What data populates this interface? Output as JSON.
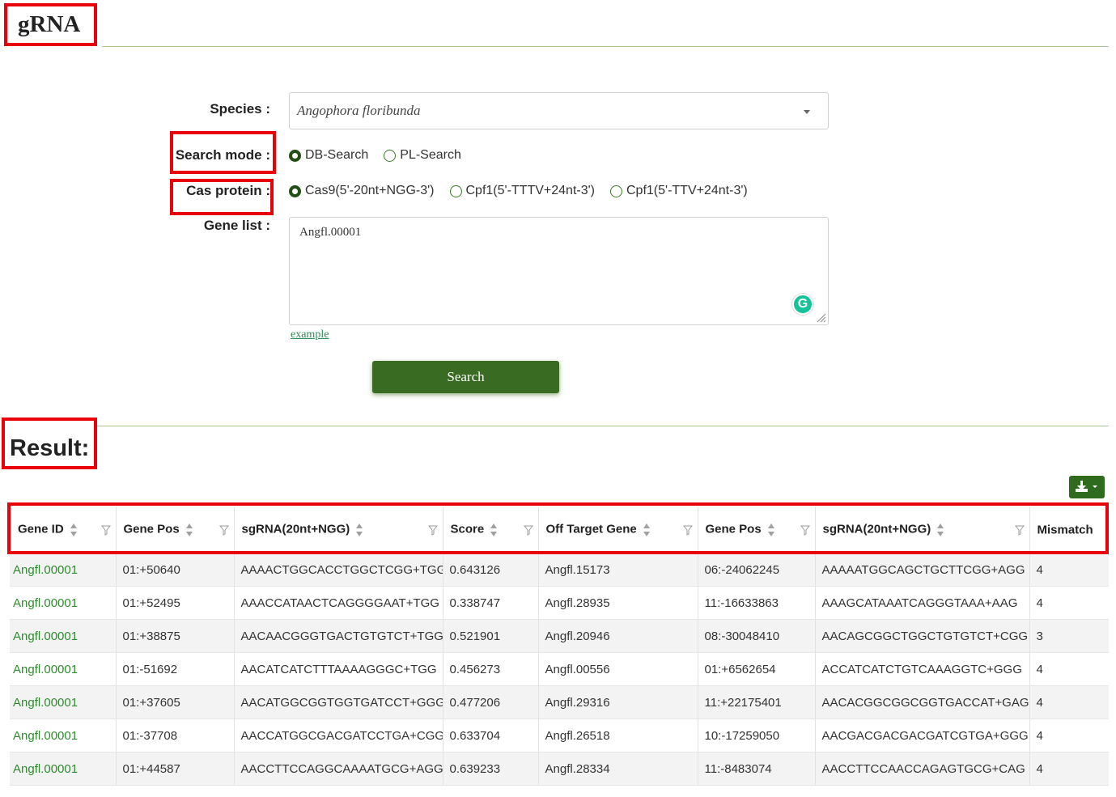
{
  "page": {
    "title": "gRNA",
    "result_heading": "Result:"
  },
  "form": {
    "species_label": "Species :",
    "species_value": "Angophora floribunda",
    "search_mode_label": "Search mode :",
    "search_mode_options": [
      {
        "label": "DB-Search",
        "selected": true
      },
      {
        "label": "PL-Search",
        "selected": false
      }
    ],
    "cas_label": "Cas protein :",
    "cas_options": [
      {
        "label": "Cas9(5'-20nt+NGG-3')",
        "selected": true
      },
      {
        "label": "Cpf1(5'-TTTV+24nt-3')",
        "selected": false
      },
      {
        "label": "Cpf1(5'-TTV+24nt-3')",
        "selected": false
      }
    ],
    "gene_list_label": "Gene list :",
    "gene_list_value": "Angfl.00001",
    "grammar_icon_letter": "G",
    "example_link": "example",
    "search_button": "Search"
  },
  "colors": {
    "accent_green": "#3a6b23",
    "link_green": "#2e8b2e",
    "highlight_red": "#e8000b",
    "divider_green": "#a6c98f"
  },
  "table": {
    "headers": [
      "Gene ID",
      "Gene Pos",
      "sgRNA(20nt+NGG)",
      "Score",
      "Off Target Gene",
      "Gene Pos",
      "sgRNA(20nt+NGG)",
      "Mismatch"
    ],
    "rows": [
      [
        "Angfl.00001",
        "01:+50640",
        "AAAACTGGCACCTGGCTCGG+TGG",
        "0.643126",
        "Angfl.15173",
        "06:-24062245",
        "AAAAATGGCAGCTGCTTCGG+AGG",
        "4"
      ],
      [
        "Angfl.00001",
        "01:+52495",
        "AAACCATAACTCAGGGGAAT+TGG",
        "0.338747",
        "Angfl.28935",
        "11:-16633863",
        "AAAGCATAAATCAGGGTAAA+AAG",
        "4"
      ],
      [
        "Angfl.00001",
        "01:+38875",
        "AACAACGGGTGACTGTGTCT+TGG",
        "0.521901",
        "Angfl.20946",
        "08:-30048410",
        "AACAGCGGCTGGCTGTGTCT+CGG",
        "3"
      ],
      [
        "Angfl.00001",
        "01:-51692",
        "AACATCATCTTTAAAAGGGC+TGG",
        "0.456273",
        "Angfl.00556",
        "01:+6562654",
        "ACCATCATCTGTCAAAGGTC+GGG",
        "4"
      ],
      [
        "Angfl.00001",
        "01:+37605",
        "AACATGGCGGTGGTGATCCT+GGG",
        "0.477206",
        "Angfl.29316",
        "11:+22175401",
        "AACACGGCGGCGGTGACCAT+GAG",
        "4"
      ],
      [
        "Angfl.00001",
        "01:-37708",
        "AACCATGGCGACGATCCTGA+CGG",
        "0.633704",
        "Angfl.26518",
        "10:-17259050",
        "AACGACGACGACGATCGTGA+GGG",
        "4"
      ],
      [
        "Angfl.00001",
        "01:+44587",
        "AACCTTCCAGGCAAAATGCG+AGG",
        "0.639233",
        "Angfl.28334",
        "11:-8483074",
        "AACCTTCCAACCAGAGTGCG+CAG",
        "4"
      ]
    ]
  }
}
